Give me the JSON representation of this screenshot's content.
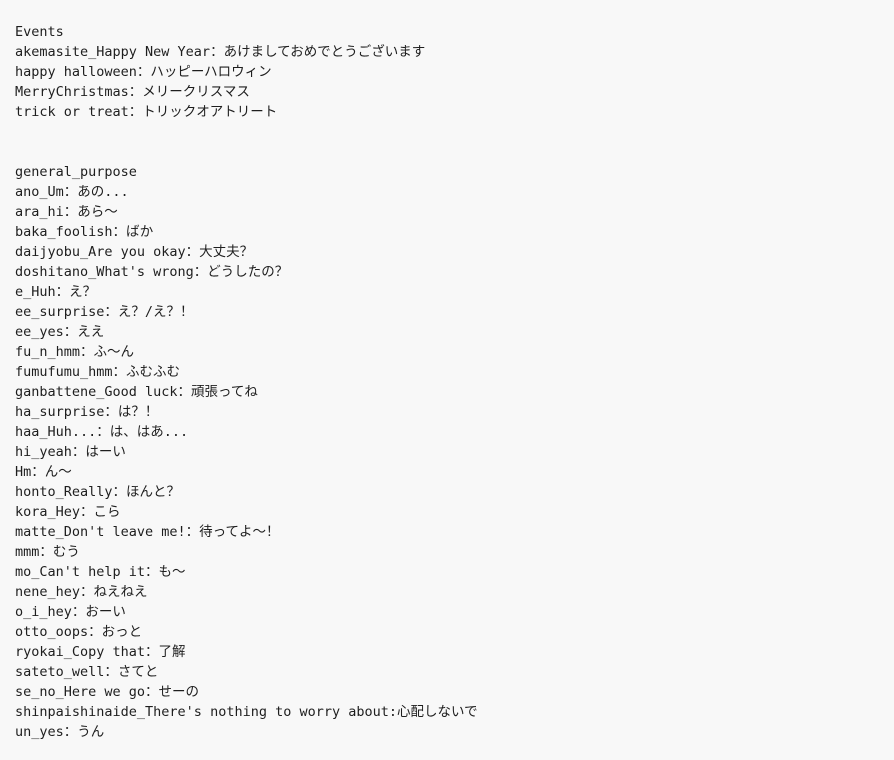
{
  "document": {
    "background_color": "#f8f8f8",
    "text_color": "#1e1e1e",
    "sections": [
      {
        "id": "events",
        "heading": "Events",
        "lines": [
          "akemasite_Happy New Year：あけましておめでとうございます",
          "happy halloween：ハッピーハロウィン",
          "MerryChristmas：メリークリスマス",
          "trick or treat：トリックオアトリート"
        ]
      },
      {
        "id": "general_purpose",
        "heading": "general_purpose",
        "lines": [
          "ano_Um：あの...",
          "ara_hi：あら〜",
          "baka_foolish：ばか",
          "daijyobu_Are you okay：大丈夫？",
          "doshitano_What's wrong：どうしたの？",
          "e_Huh：え？",
          "ee_surprise：え？/え？！",
          "ee_yes：ええ",
          "fu_n_hmm：ふ〜ん",
          "fumufumu_hmm：ふむふむ",
          "ganbattene_Good luck：頑張ってね",
          "ha_surprise：は？！",
          "haa_Huh...：は、はあ...",
          "hi_yeah：はーい",
          "Hm：ん〜",
          "honto_Really：ほんと？",
          "kora_Hey：こら",
          "matte_Don't leave me!：待ってよ〜！",
          "mmm：むう",
          "mo_Can't help it：も〜",
          "nene_hey：ねえねえ",
          "o_i_hey：おーい",
          "otto_oops：おっと",
          "ryokai_Copy that：了解",
          "sateto_well：さてと",
          "se_no_Here we go：せーの",
          "shinpaishinaide_There's nothing to worry about:心配しないで",
          "un_yes：うん"
        ]
      }
    ]
  }
}
